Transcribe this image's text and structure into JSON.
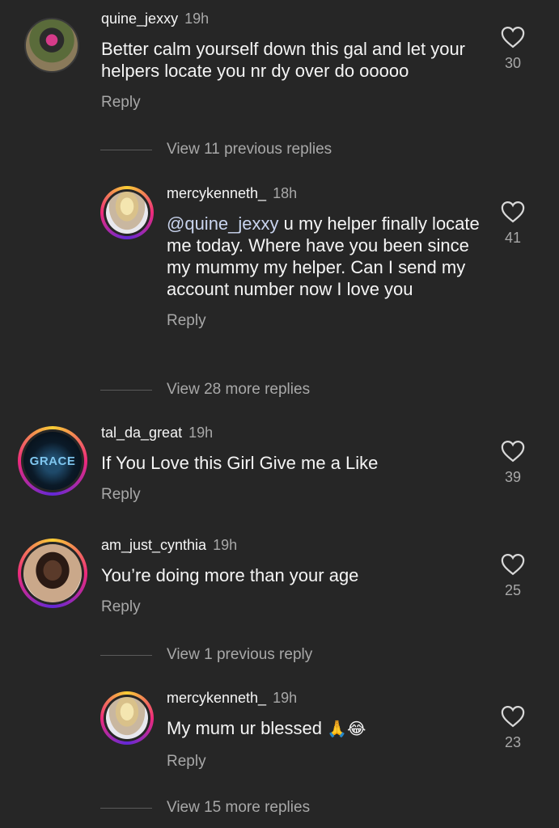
{
  "comments": [
    {
      "username": "quine_jexxy",
      "time": "19h",
      "text": "Better calm yourself down this gal and let your helpers locate you nr dy over do ooooo",
      "reply": "Reply",
      "likes": "30",
      "avatar_icon": "pink-mask-avatar"
    },
    {
      "username": "mercykenneth_",
      "time": "18h",
      "mention": "@quine_jexxy",
      "text": " u my helper finally locate me today. Where have you been since my mummy my helper. Can I send my account number now I love you",
      "reply": "Reply",
      "likes": "41",
      "avatar_icon": "blonde-woman-avatar"
    },
    {
      "username": "tal_da_great",
      "time": "19h",
      "text": "If You Love this Girl Give me a Like",
      "reply": "Reply",
      "likes": "39",
      "avatar_text": "GRACE",
      "avatar_icon": "praying-hands-grace-avatar"
    },
    {
      "username": "am_just_cynthia",
      "time": "19h",
      "text": "You’re doing more than your age",
      "reply": "Reply",
      "likes": "25",
      "avatar_icon": "woman-portrait-avatar"
    },
    {
      "username": "mercykenneth_",
      "time": "19h",
      "text": "My mum ur blessed ",
      "emoji": "🙏😂",
      "reply": "Reply",
      "likes": "23",
      "avatar_icon": "blonde-woman-avatar"
    }
  ],
  "view_replies": {
    "first": "View 11 previous replies",
    "second": "View 28 more replies",
    "third": "View 1 previous reply",
    "fourth": "View 15 more replies"
  },
  "colors": {
    "background": "#262626",
    "primary_text": "#f5f5f5",
    "secondary_text": "#a8a8a8",
    "mention": "#c9d4ee"
  }
}
